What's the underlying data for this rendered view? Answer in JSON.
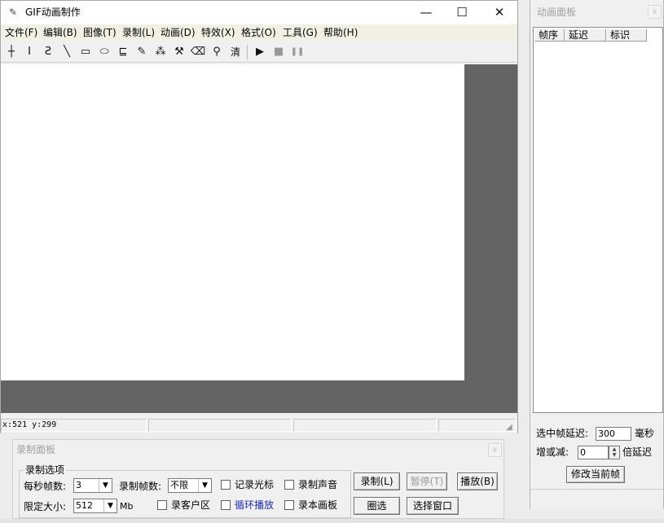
{
  "main_window": {
    "title": "GIF动画制作",
    "controls": {
      "minimize": "—",
      "maximize": "☐",
      "close": "✕"
    },
    "menu": [
      "文件(F)",
      "编辑(B)",
      "图像(T)",
      "录制(L)",
      "动画(D)",
      "特效(X)",
      "格式(O)",
      "工具(G)",
      "帮助(H)"
    ],
    "toolbar": {
      "tools": [
        {
          "name": "crosshair-icon",
          "glyph": "┼"
        },
        {
          "name": "text-cursor-icon",
          "glyph": "I"
        },
        {
          "name": "freehand-icon",
          "glyph": "Ƨ"
        },
        {
          "name": "line-icon",
          "glyph": "╲"
        },
        {
          "name": "rectangle-icon",
          "glyph": "▭"
        },
        {
          "name": "ellipse-icon",
          "glyph": "⬭"
        },
        {
          "name": "polygon-icon",
          "glyph": "⊑"
        },
        {
          "name": "pencil-icon",
          "glyph": "✎"
        },
        {
          "name": "spray-icon",
          "glyph": "⁂"
        },
        {
          "name": "brush-icon",
          "glyph": "⚒"
        },
        {
          "name": "eraser-icon",
          "glyph": "⌫"
        },
        {
          "name": "eyedropper-icon",
          "glyph": "⚲"
        }
      ],
      "clear_label": "清",
      "playback": [
        {
          "name": "play-icon",
          "glyph": "▶"
        },
        {
          "name": "stop-icon",
          "glyph": "■"
        },
        {
          "name": "pause-icon",
          "glyph": "❚❚"
        }
      ]
    },
    "status": {
      "coordinates": "x:521 y:299"
    }
  },
  "animation_panel": {
    "title": "动画面板",
    "close": "x",
    "columns": [
      "帧序",
      "延迟",
      "标识"
    ],
    "frames": [],
    "delay_label": "选中帧延迟:",
    "delay_value": "300",
    "delay_unit": "毫秒",
    "adjust_label": "增或减:",
    "adjust_value": "0",
    "adjust_unit": "倍延迟",
    "apply_button": "修改当前帧"
  },
  "record_panel": {
    "title": "录制面板",
    "close": "x",
    "group_label": "录制选项",
    "fps_label": "每秒帧数:",
    "fps_value": "3",
    "frames_label": "录制帧数:",
    "frames_value": "不限",
    "size_label": "限定大小:",
    "size_value": "512",
    "size_unit": "Mb",
    "checkboxes": {
      "record_cursor": "记录光标",
      "record_sound": "录制声音",
      "record_client": "录客户区",
      "loop_play": "循环播放",
      "record_canvas": "录本画板"
    },
    "buttons": {
      "record": "录制(L)",
      "pause": "暂停(T)",
      "play": "播放(B)",
      "select_area": "圈选",
      "select_window": "选择窗口"
    }
  }
}
